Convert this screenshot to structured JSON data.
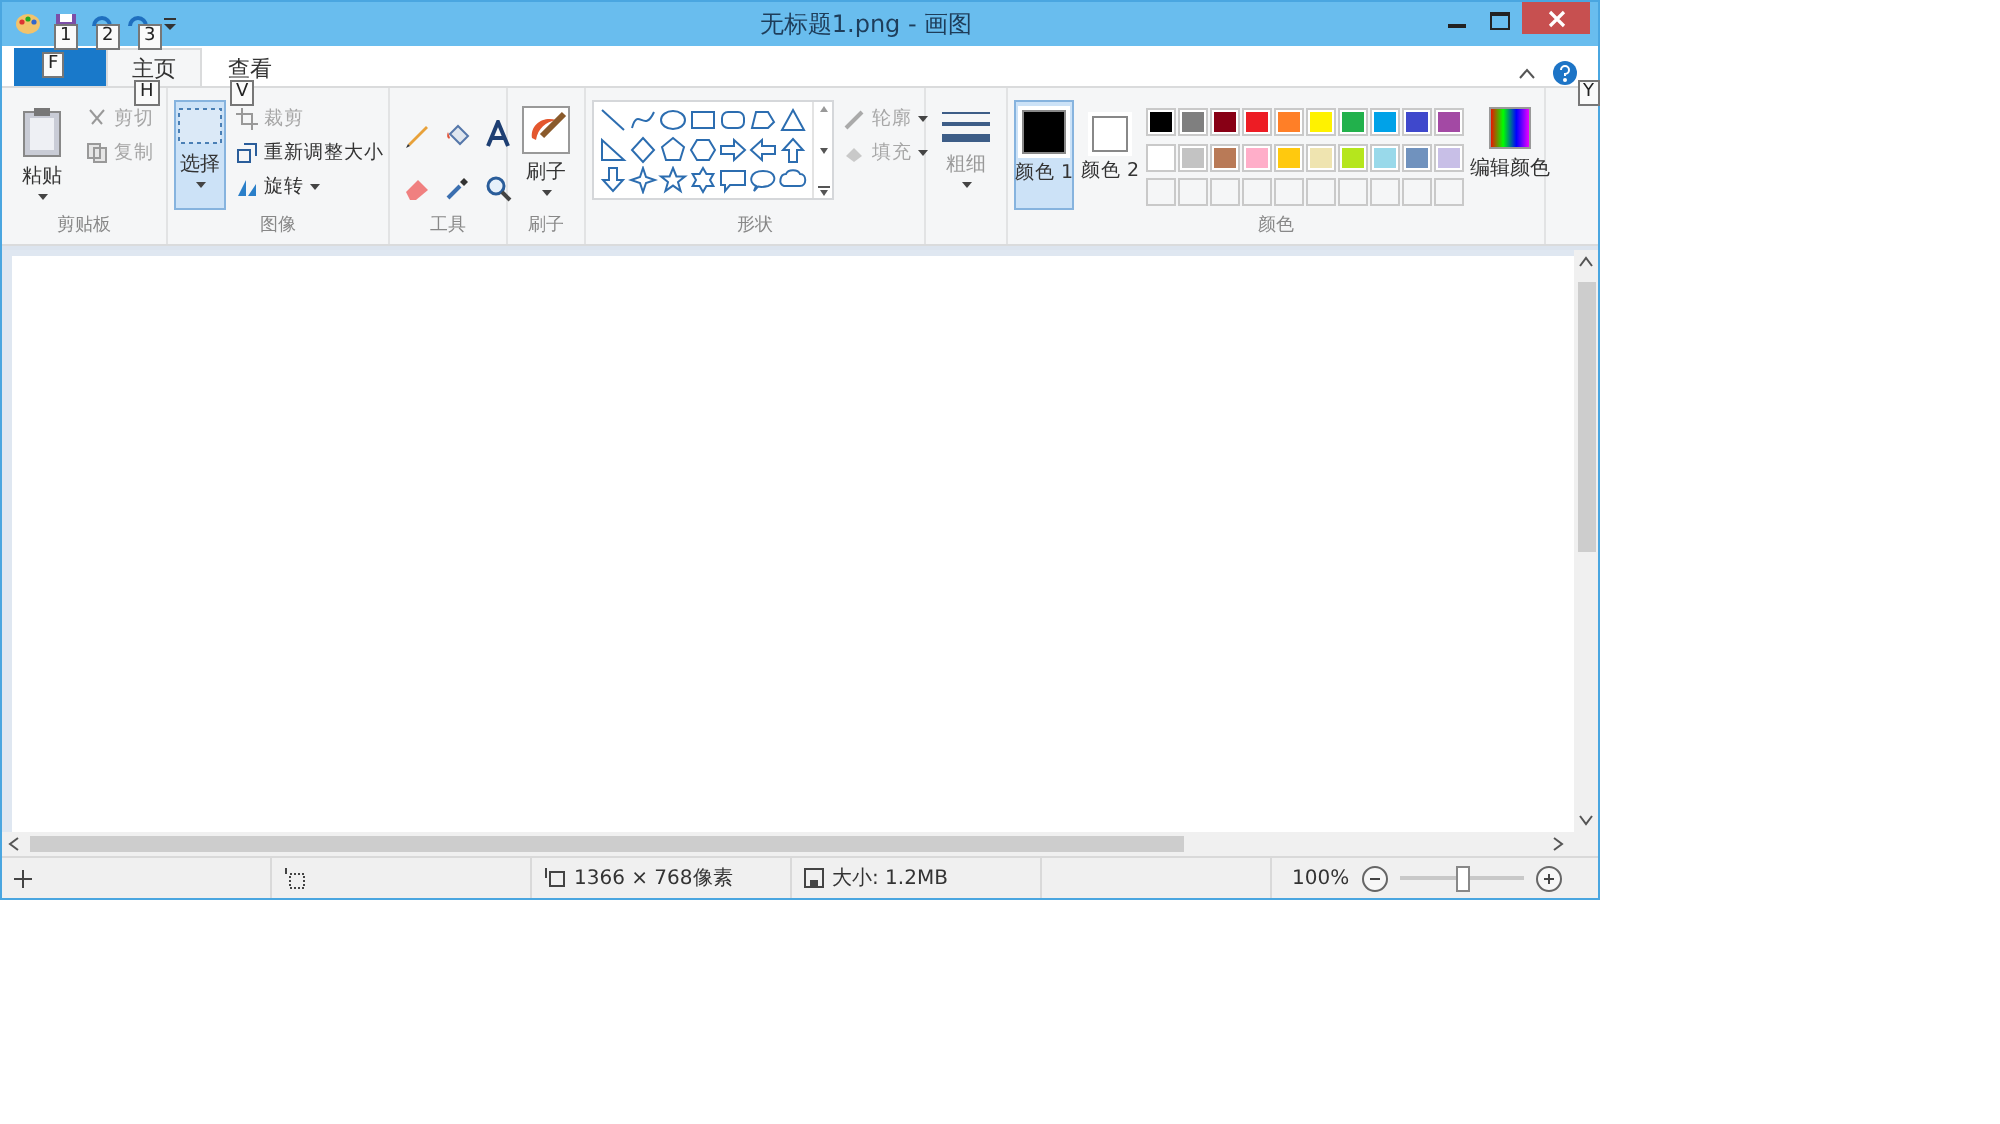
{
  "window": {
    "title": "无标题1.png - 画图"
  },
  "quick_access": [
    {
      "keytip": "1"
    },
    {
      "keytip": "2"
    },
    {
      "keytip": "3"
    }
  ],
  "tabs": [
    {
      "kind": "file",
      "keytip": "F",
      "selected": false
    },
    {
      "kind": "tab",
      "label": "主页",
      "keytip": "H",
      "selected": true
    },
    {
      "kind": "tab",
      "label": "查看",
      "keytip": "V",
      "selected": false
    }
  ],
  "help": {
    "keytip": "Y"
  },
  "clipboard": {
    "label": "剪贴板",
    "paste": "粘贴",
    "cut": {
      "label": "剪切",
      "disabled": true
    },
    "copy": {
      "label": "复制",
      "disabled": true
    }
  },
  "image": {
    "label": "图像",
    "select": {
      "label": "选择",
      "selected": true
    },
    "crop": {
      "label": "裁剪",
      "disabled": true
    },
    "resize": {
      "label": "重新调整大小",
      "disabled": false
    },
    "rotate": {
      "label": "旋转",
      "disabled": false
    }
  },
  "tools": {
    "label": "工具"
  },
  "brushes": {
    "button": "刷子",
    "label": "刷子"
  },
  "shapes": {
    "label": "形状",
    "outline": {
      "label": "轮廓",
      "disabled": true
    },
    "fill": {
      "label": "填充",
      "disabled": true
    }
  },
  "size": {
    "label": "粗细",
    "disabled": true
  },
  "colors": {
    "label": "颜色",
    "color1": {
      "label": "颜色 1",
      "color": "#000000",
      "selected": true
    },
    "color2": {
      "label": "颜色 2",
      "color": "#ffffff",
      "selected": false
    },
    "edit": "编辑颜色",
    "palette": [
      {
        "kind": "color",
        "color": "#000000"
      },
      {
        "kind": "color",
        "color": "#7f7f7f"
      },
      {
        "kind": "color",
        "color": "#880015"
      },
      {
        "kind": "color",
        "color": "#ed1c24"
      },
      {
        "kind": "color",
        "color": "#ff7f27"
      },
      {
        "kind": "color",
        "color": "#fff200"
      },
      {
        "kind": "color",
        "color": "#22b14c"
      },
      {
        "kind": "color",
        "color": "#00a2e8"
      },
      {
        "kind": "color",
        "color": "#3f48cc"
      },
      {
        "kind": "color",
        "color": "#a349a4"
      },
      {
        "kind": "color",
        "color": "#ffffff"
      },
      {
        "kind": "color",
        "color": "#c3c3c3"
      },
      {
        "kind": "color",
        "color": "#b97a57"
      },
      {
        "kind": "color",
        "color": "#ffaec9"
      },
      {
        "kind": "color",
        "color": "#ffc90e"
      },
      {
        "kind": "color",
        "color": "#efe4b0"
      },
      {
        "kind": "color",
        "color": "#b5e61d"
      },
      {
        "kind": "color",
        "color": "#99d9ea"
      },
      {
        "kind": "color",
        "color": "#7092be"
      },
      {
        "kind": "color",
        "color": "#c8bfe7"
      },
      {
        "kind": "empty"
      },
      {
        "kind": "empty"
      },
      {
        "kind": "empty"
      },
      {
        "kind": "empty"
      },
      {
        "kind": "empty"
      },
      {
        "kind": "empty"
      },
      {
        "kind": "empty"
      },
      {
        "kind": "empty"
      },
      {
        "kind": "empty"
      },
      {
        "kind": "empty"
      }
    ]
  },
  "status_bar": {
    "dimensions": "1366 × 768像素",
    "file_size": "大小: 1.2MB",
    "zoom": "100%",
    "zoom_level": {
      "level": 0.5
    }
  }
}
